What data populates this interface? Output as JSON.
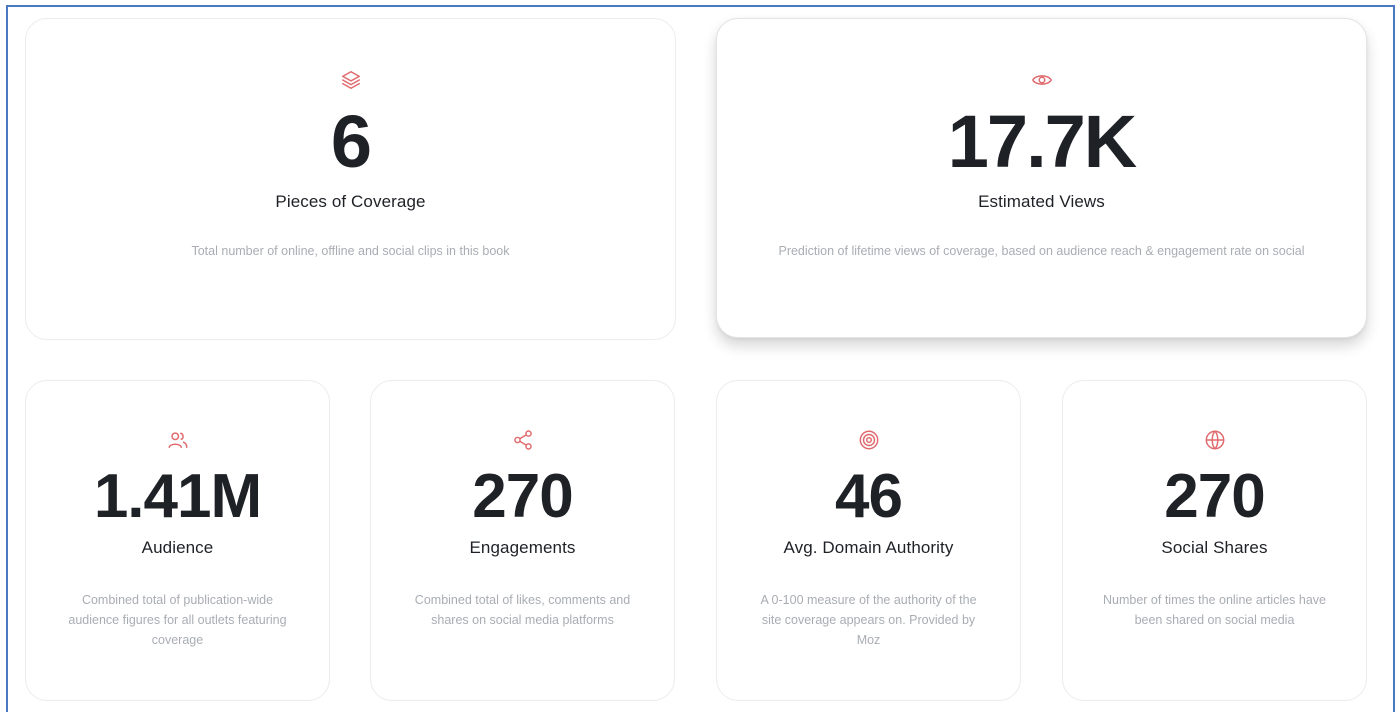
{
  "accent_color": "#e06a6e",
  "cards": [
    {
      "id": "coverage",
      "icon": "layers-icon",
      "value": "6",
      "label": "Pieces of Coverage",
      "description": "Total number of online, offline and social clips in this book"
    },
    {
      "id": "views",
      "icon": "eye-icon",
      "value": "17.7K",
      "label": "Estimated Views",
      "description": "Prediction of lifetime views of coverage, based on audience reach & engagement rate on social"
    },
    {
      "id": "audience",
      "icon": "users-icon",
      "value": "1.41M",
      "label": "Audience",
      "description": "Combined total of publication-wide audience figures for all outlets featuring coverage"
    },
    {
      "id": "engagements",
      "icon": "share-icon",
      "value": "270",
      "label": "Engagements",
      "description": "Combined total of likes, comments and shares on social media platforms"
    },
    {
      "id": "domain_authority",
      "icon": "target-icon",
      "value": "46",
      "label": "Avg. Domain Authority",
      "description": "A 0-100 measure of the authority of the site coverage appears on. Provided by Moz"
    },
    {
      "id": "social_shares",
      "icon": "globe-icon",
      "value": "270",
      "label": "Social Shares",
      "description": "Number of times the online articles have been shared on social media"
    }
  ]
}
